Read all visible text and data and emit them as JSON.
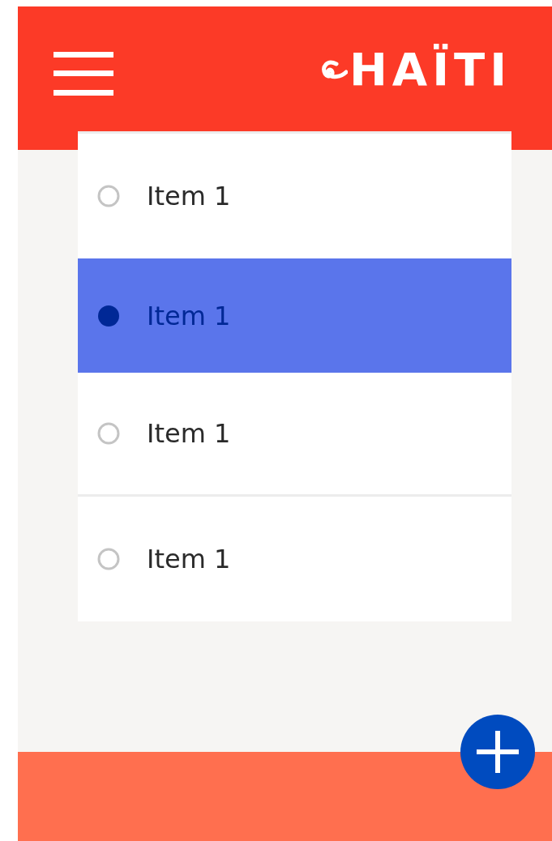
{
  "header": {
    "logo": "HAÏTI"
  },
  "items": [
    {
      "label": "Item 1",
      "selected": false
    },
    {
      "label": "Item 1",
      "selected": true
    },
    {
      "label": "Item 1",
      "selected": false
    },
    {
      "label": "Item 1",
      "selected": false
    }
  ]
}
